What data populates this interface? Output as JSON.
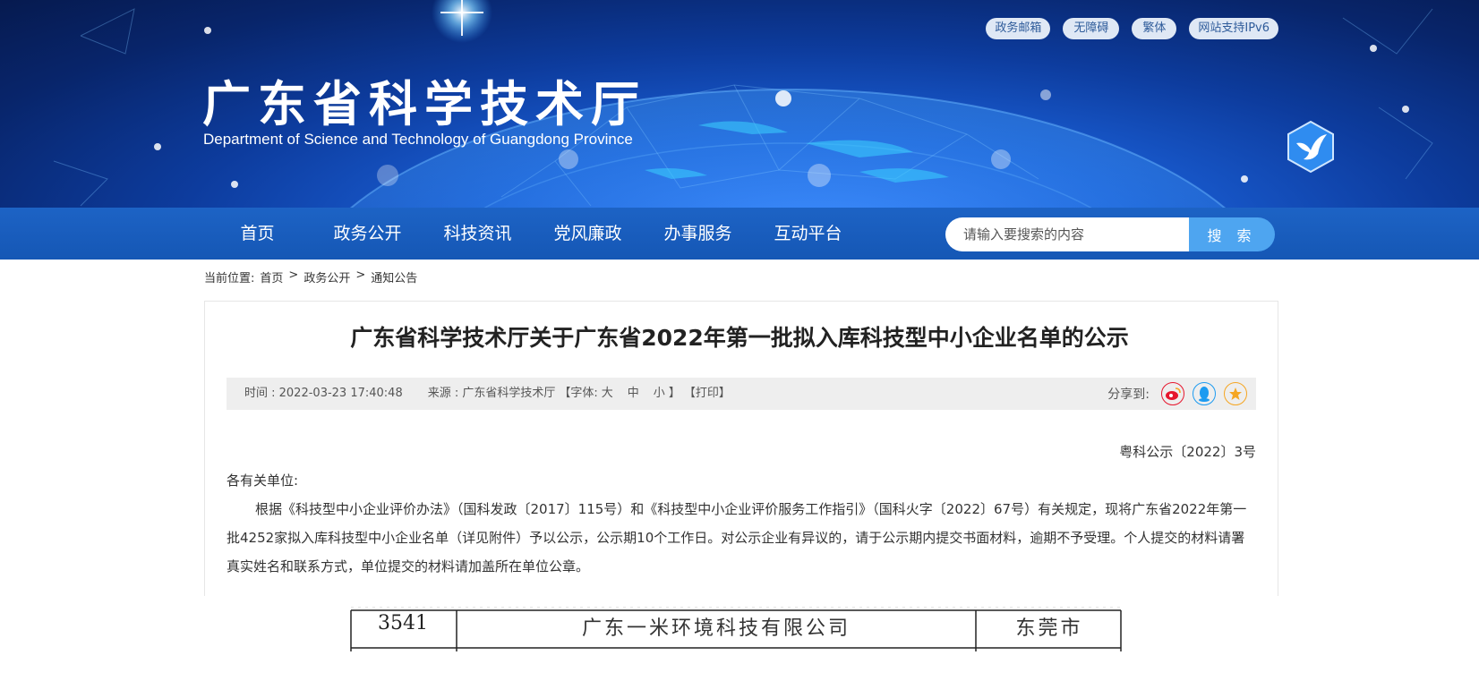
{
  "header": {
    "title": "广东省科学技术厅",
    "subtitle": "Department of Science and Technology of Guangdong Province",
    "top_links": [
      "政务邮箱",
      "无障碍",
      "繁体",
      "网站支持IPv6"
    ]
  },
  "nav": {
    "items": [
      "首页",
      "政务公开",
      "科技资讯",
      "党风廉政",
      "办事服务",
      "互动平台"
    ],
    "search_placeholder": "请输入要搜索的内容",
    "search_button": "搜 索"
  },
  "breadcrumb": {
    "label": "当前位置:",
    "items": [
      "首页",
      "政务公开",
      "通知公告"
    ],
    "separator": ">"
  },
  "article": {
    "title": "广东省科学技术厅关于广东省2022年第一批拟入库科技型中小企业名单的公示",
    "meta": {
      "time": "时间 : 2022-03-23 17:40:48",
      "source": "来源 : 广东省科学技术厅",
      "font_label": "【字体:",
      "font_sizes": [
        "大",
        "中",
        "小"
      ],
      "font_close": "】",
      "print": "【打印】",
      "share_label": "分享到:"
    },
    "doc_number": "粤科公示〔2022〕3号",
    "salutation": "各有关单位:",
    "body": "根据《科技型中小企业评价办法》（国科发政〔2017〕115号）和《科技型中小企业评价服务工作指引》（国科火字〔2022〕67号）有关规定，现将广东省2022年第一批4252家拟入库科技型中小企业名单（详见附件）予以公示，公示期10个工作日。对公示企业有异议的，请于公示期内提交书面材料，逾期不予受理。个人提交的材料请署真实姓名和联系方式，单位提交的材料请加盖所在单位公章。"
  },
  "attachment_row": {
    "number": "3541",
    "company": "广东一米环境科技有限公司",
    "city": "东莞市"
  },
  "colors": {
    "nav_bg": "#1557b5",
    "search_button": "#4ea5f0",
    "weibo": "#e6162d",
    "qq": "#1d9bf0",
    "favorite": "#f5a623"
  }
}
